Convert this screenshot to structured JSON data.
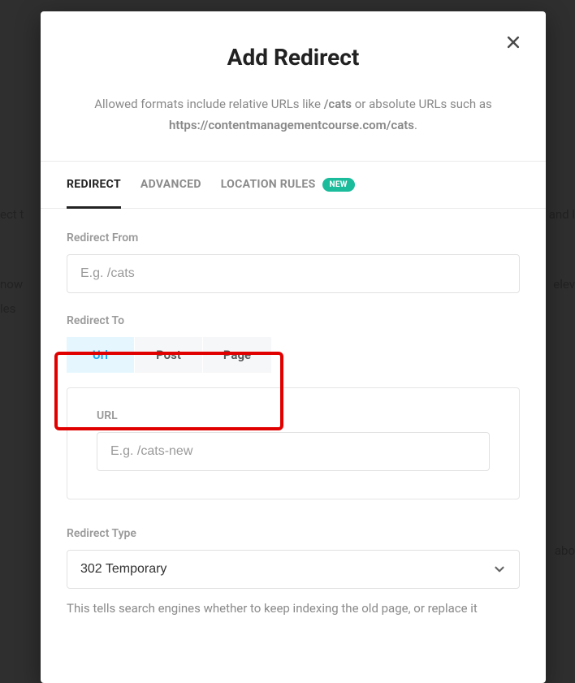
{
  "modal": {
    "title": "Add Redirect",
    "subtitle_pre": "Allowed formats include relative URLs like ",
    "subtitle_bold": "/cats",
    "subtitle_mid": " or absolute URLs such as ",
    "subtitle_url": "https://contentmanagementcourse.com/cats",
    "subtitle_post": "."
  },
  "tabs": {
    "redirect": "REDIRECT",
    "advanced": "ADVANCED",
    "location_rules": "LOCATION RULES",
    "new_badge": "NEW"
  },
  "form": {
    "redirect_from": {
      "label": "Redirect From",
      "placeholder": "E.g. /cats",
      "value": ""
    },
    "redirect_to": {
      "label": "Redirect To",
      "options": {
        "url": "Url",
        "post": "Post",
        "page": "Page"
      }
    },
    "url": {
      "label": "URL",
      "placeholder": "E.g. /cats-new",
      "value": ""
    },
    "redirect_type": {
      "label": "Redirect Type",
      "value": "302 Temporary",
      "help": "This tells search engines whether to keep indexing the old page, or replace it"
    }
  },
  "background": {
    "t1": "ect t",
    "t2": "and l",
    "t3": "now",
    "t4": "elev",
    "t5": "les",
    "t6": "abo"
  }
}
